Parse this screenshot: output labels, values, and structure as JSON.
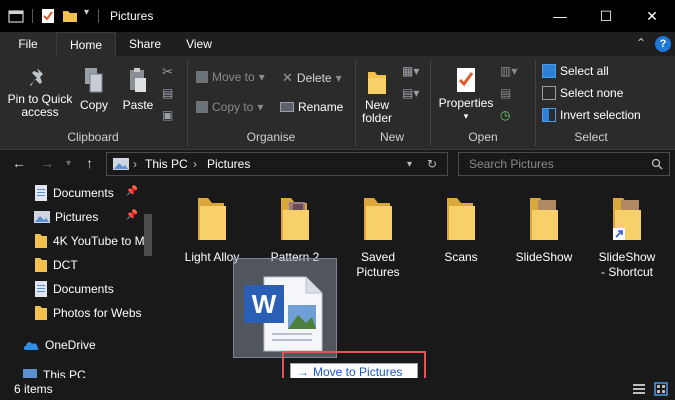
{
  "window": {
    "title": "Pictures",
    "controls": {
      "minimize": "—",
      "maximize": "☐",
      "close": "✕"
    }
  },
  "ribbon_tabs": [
    "File",
    "Home",
    "Share",
    "View"
  ],
  "ribbon": {
    "clipboard": {
      "label": "Clipboard",
      "pin_line1": "Pin to Quick",
      "pin_line2": "access",
      "copy": "Copy",
      "paste": "Paste"
    },
    "organise": {
      "label": "Organise",
      "move_to": "Move to",
      "copy_to": "Copy to",
      "delete": "Delete",
      "rename": "Rename"
    },
    "new": {
      "label": "New",
      "new_folder_line1": "New",
      "new_folder_line2": "folder"
    },
    "open": {
      "label": "Open",
      "properties": "Properties"
    },
    "select": {
      "label": "Select",
      "select_all": "Select all",
      "select_none": "Select none",
      "invert": "Invert selection"
    }
  },
  "address": {
    "crumbs": [
      "This PC",
      "Pictures"
    ],
    "search_placeholder": "Search Pictures"
  },
  "nav_pane": [
    {
      "label": "Documents",
      "icon": "documents-icon",
      "pinned": true
    },
    {
      "label": "Pictures",
      "icon": "pictures-icon",
      "pinned": true
    },
    {
      "label": "4K YouTube to M",
      "icon": "folder-icon",
      "pinned": false
    },
    {
      "label": "DCT",
      "icon": "folder-icon",
      "pinned": false
    },
    {
      "label": "Documents",
      "icon": "documents-icon",
      "pinned": false
    },
    {
      "label": "Photos for Webs",
      "icon": "folder-icon",
      "pinned": false
    },
    {
      "label": "OneDrive",
      "icon": "onedrive-icon",
      "pinned": false
    },
    {
      "label": "This PC",
      "icon": "pc-icon",
      "pinned": false
    }
  ],
  "files": [
    {
      "name": "Light Alloy",
      "line2": "",
      "type": "folder"
    },
    {
      "name": "Pattern 2",
      "line2": "",
      "type": "folder-photo"
    },
    {
      "name": "Saved",
      "line2": "Pictures",
      "type": "folder"
    },
    {
      "name": "Scans",
      "line2": "",
      "type": "folder"
    },
    {
      "name": "SlideShow",
      "line2": "",
      "type": "folder-photo"
    },
    {
      "name": "SlideShow",
      "line2": "- Shortcut",
      "type": "folder-shortcut"
    }
  ],
  "drag": {
    "tooltip": "Move to Pictures"
  },
  "status": {
    "item_count": "6 items"
  },
  "colors": {
    "folder": "#f2c14e",
    "accent": "#1e78d7",
    "highlight_box": "#e05454"
  }
}
